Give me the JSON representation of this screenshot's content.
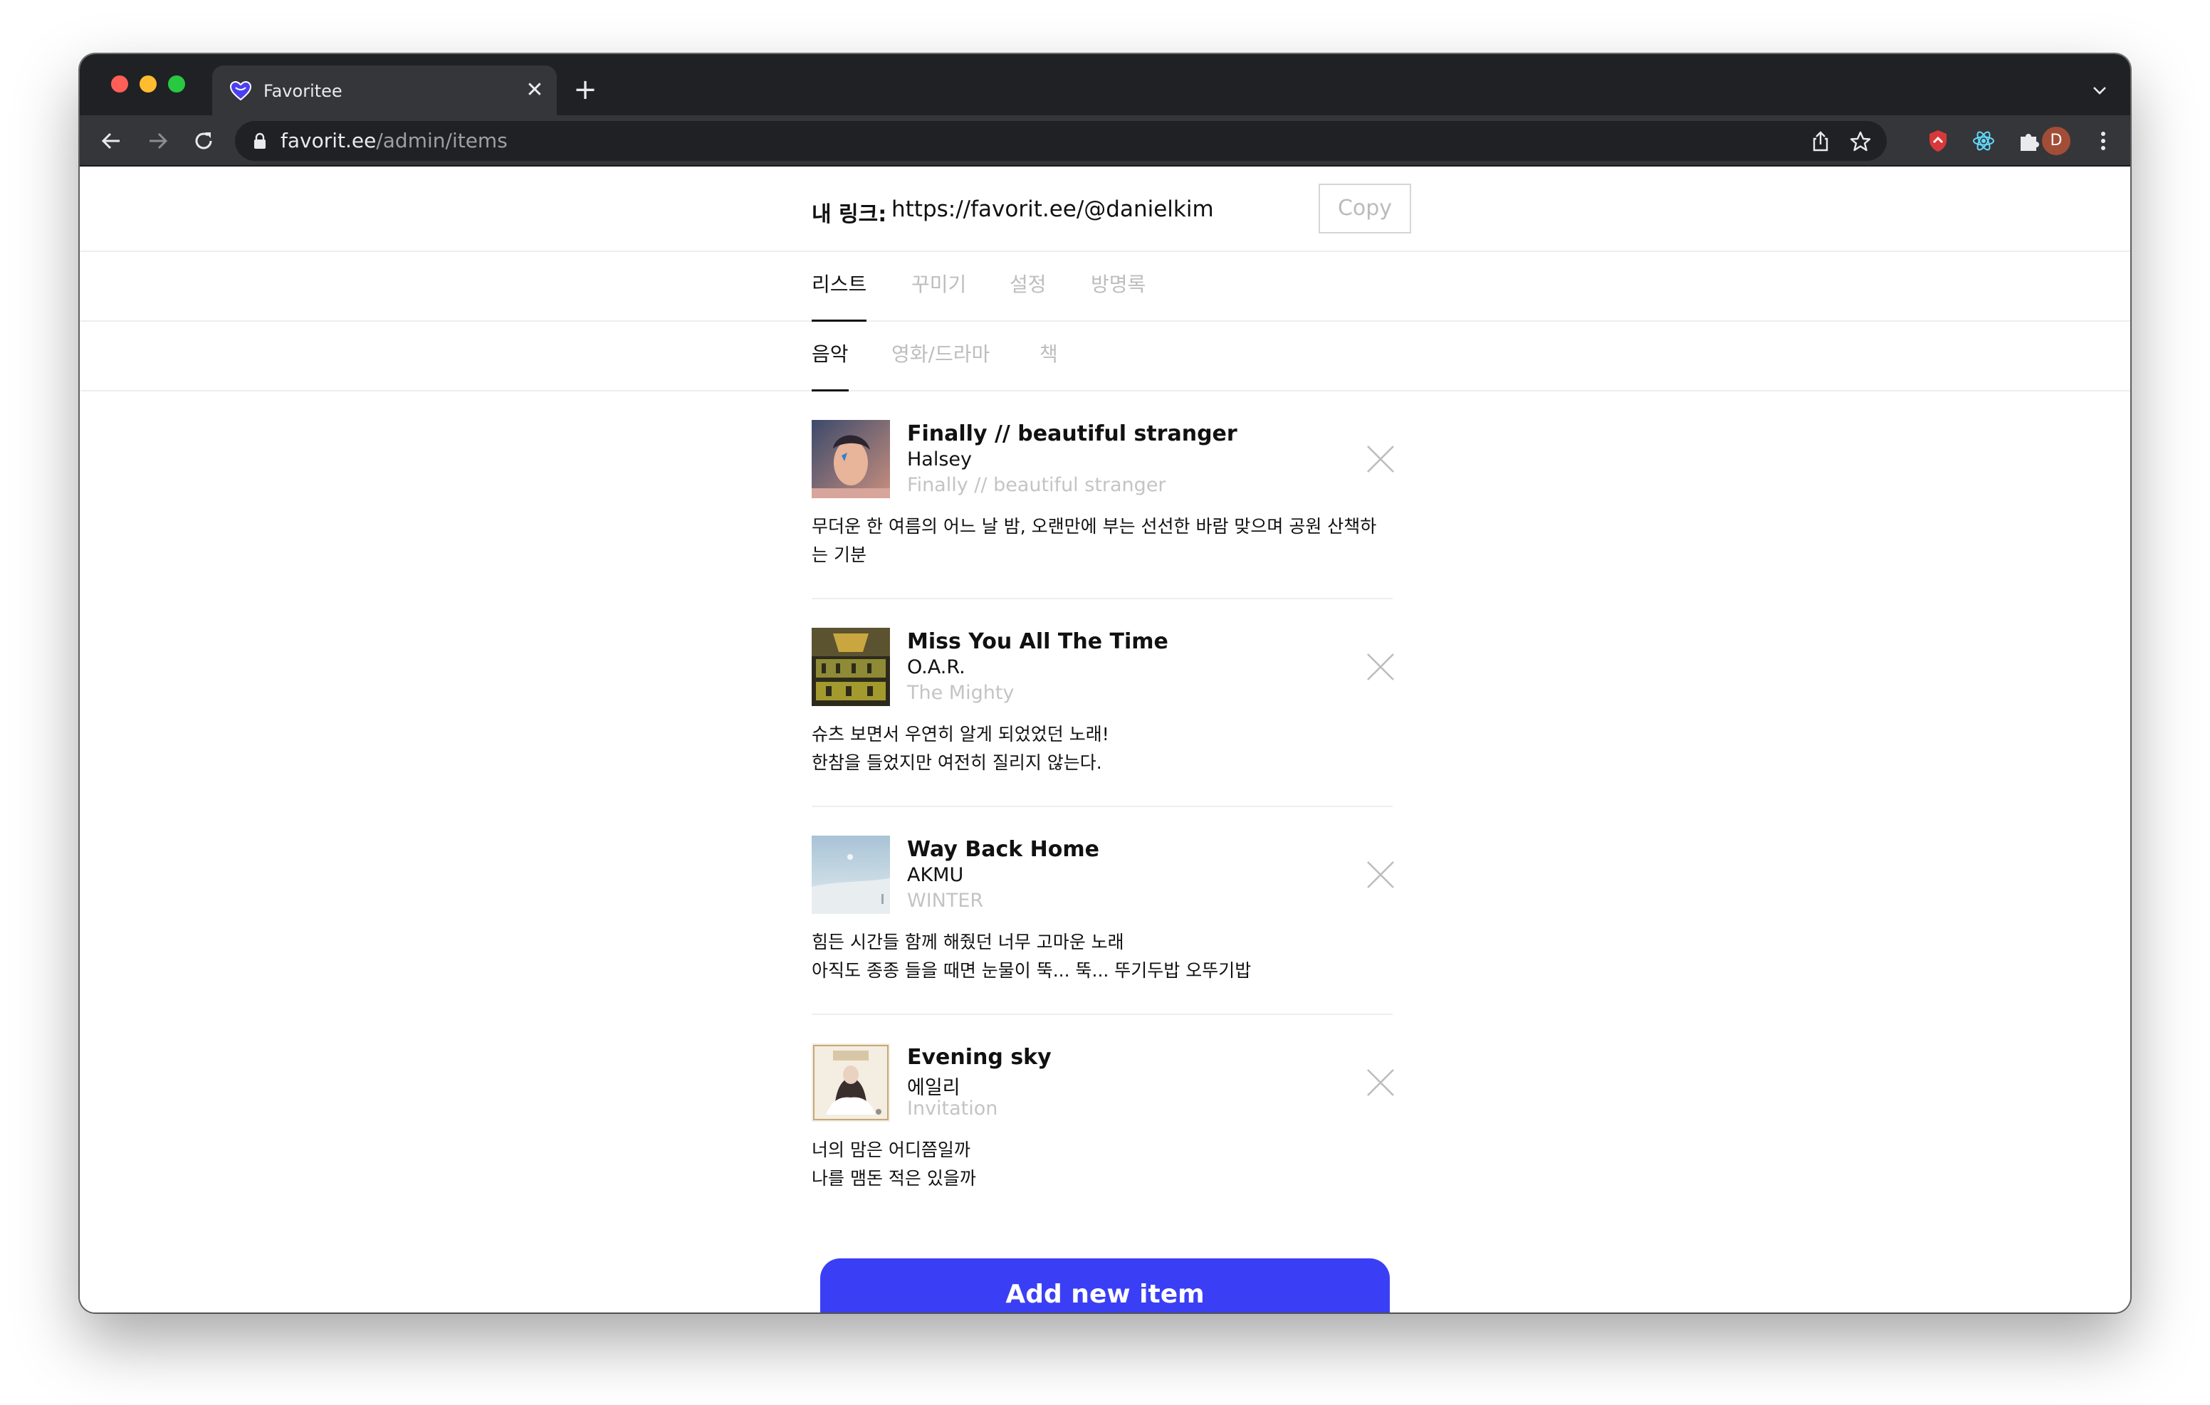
{
  "browser": {
    "tab_title": "Favoritee",
    "url_domain": "favorit.ee",
    "url_path": "/admin/items",
    "avatar_letter": "D"
  },
  "header": {
    "link_label": "내 링크:",
    "link_url": "https://favorit.ee/@danielkim",
    "copy_label": "Copy"
  },
  "main_tabs": [
    {
      "label": "리스트",
      "active": true
    },
    {
      "label": "꾸미기",
      "active": false
    },
    {
      "label": "설정",
      "active": false
    },
    {
      "label": "방명록",
      "active": false
    }
  ],
  "sub_tabs": [
    {
      "label": "음악",
      "active": true
    },
    {
      "label": "영화/드라마",
      "active": false
    },
    {
      "label": "책",
      "active": false
    }
  ],
  "items": [
    {
      "title": "Finally // beautiful stranger",
      "artist": "Halsey",
      "album": "Finally // beautiful stranger",
      "note": [
        "무더운 한 여름의 어느 날 밤, 오랜만에 부는 선선한 바람 맞으며 공원 산책하",
        "는 기분"
      ]
    },
    {
      "title": "Miss You All The Time",
      "artist": "O.A.R.",
      "album": "The Mighty",
      "note": [
        "슈츠 보면서 우연히 알게 되었었던 노래!",
        "한참을 들었지만 여전히 질리지 않는다."
      ]
    },
    {
      "title": "Way Back Home",
      "artist": "AKMU",
      "album": "WINTER",
      "note": [
        "힘든 시간들 함께 해줬던 너무 고마운 노래",
        "아직도 종종 들을 때면 눈물이 뚝... 뚝... 뚜기두밥 오뚜기밥"
      ]
    },
    {
      "title": "Evening sky",
      "artist": "에일리",
      "album": "Invitation",
      "note": [
        "너의 맘은 어디쯤일까",
        "나를 맴돈 적은 있을까"
      ]
    }
  ],
  "add_button_label": "Add new item",
  "colors": {
    "accent": "#3a3ff5",
    "chrome_dark": "#202124",
    "chrome_toolbar": "#35363a"
  }
}
